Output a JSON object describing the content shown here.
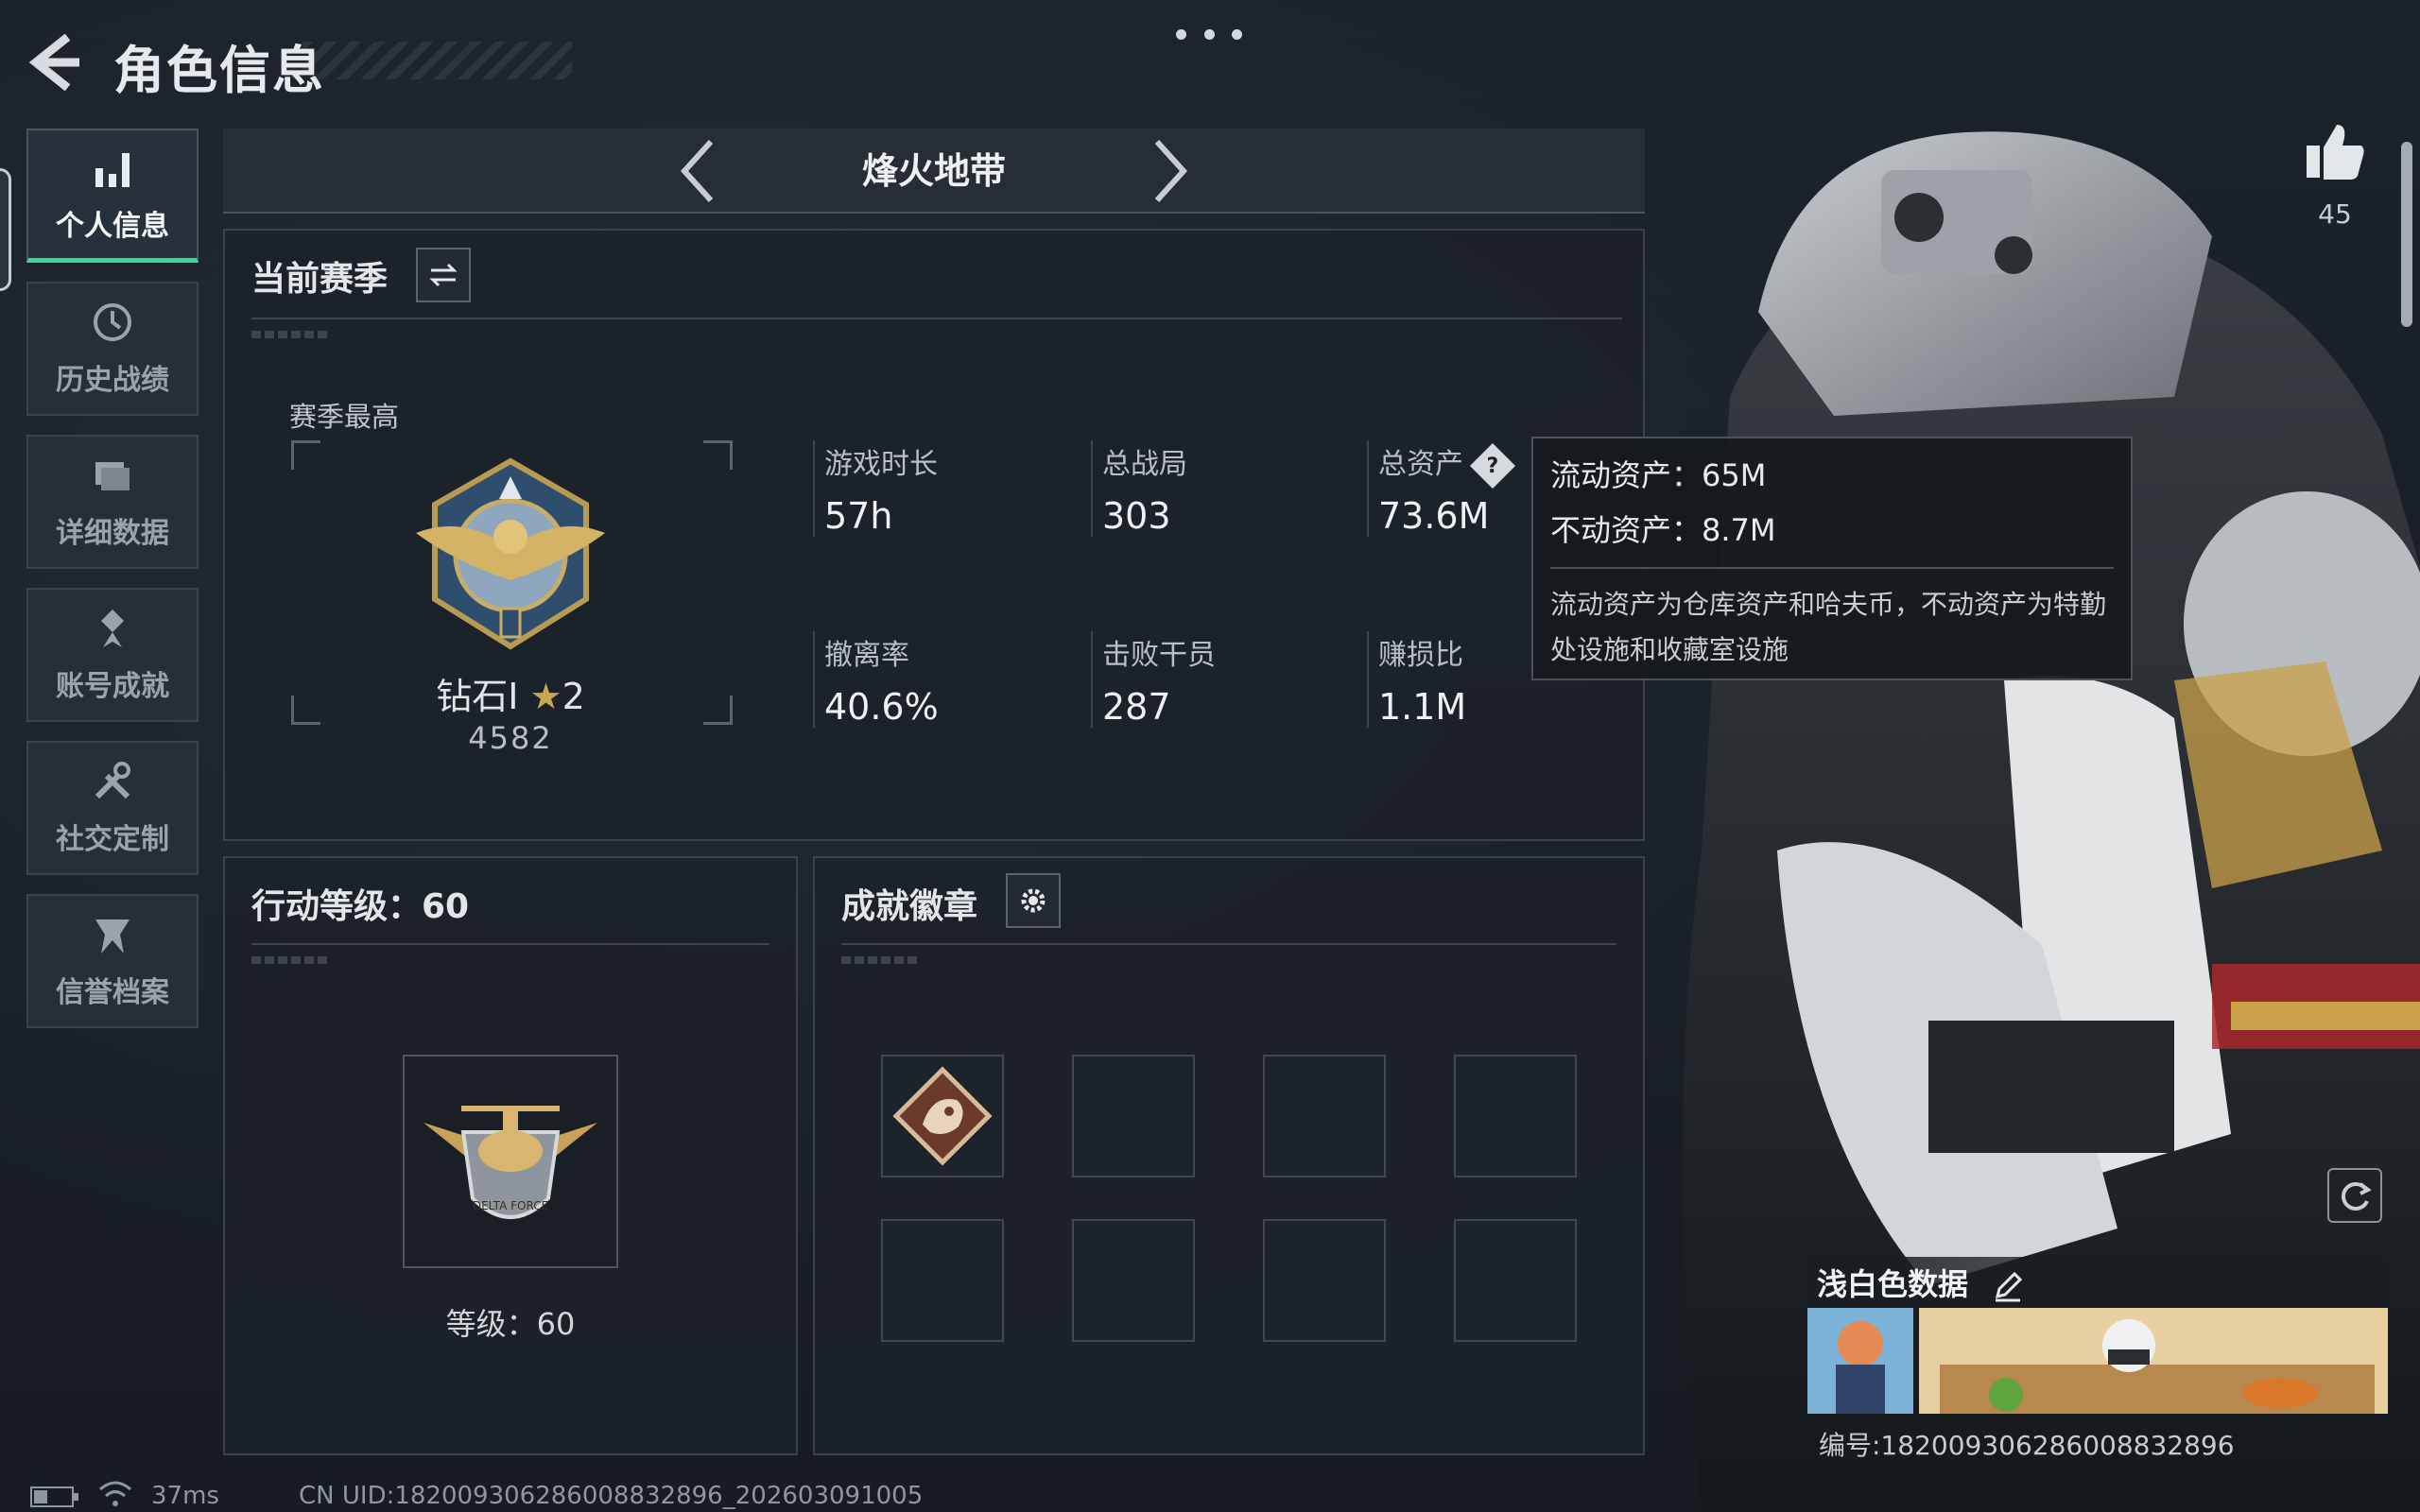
{
  "header": {
    "title": "角色信息"
  },
  "sidebar": {
    "items": [
      {
        "label": "个人信息",
        "icon": "bar-chart-icon",
        "active": true
      },
      {
        "label": "历史战绩",
        "icon": "history-clock-icon"
      },
      {
        "label": "详细数据",
        "icon": "folder-icon"
      },
      {
        "label": "账号成就",
        "icon": "achievement-star-icon"
      },
      {
        "label": "社交定制",
        "icon": "tools-icon"
      },
      {
        "label": "信誉档案",
        "icon": "credit-shield-icon"
      }
    ]
  },
  "mode": {
    "name": "烽火地带"
  },
  "season": {
    "title": "当前赛季",
    "best_label": "赛季最高",
    "rank_name": "钻石I",
    "rank_stars": "2",
    "rank_score": "4582",
    "stats": [
      {
        "key": "游戏时长",
        "value": "57h"
      },
      {
        "key": "总战局",
        "value": "303"
      },
      {
        "key": "总资产",
        "value": "73.6M"
      },
      {
        "key": "撤离率",
        "value": "40.6%"
      },
      {
        "key": "击败干员",
        "value": "287"
      },
      {
        "key": "赚损比",
        "value": "1.1M"
      }
    ]
  },
  "tooltip": {
    "liquid": "流动资产：65M",
    "fixed": "不动资产：8.7M",
    "description": "流动资产为仓库资产和哈夫币，不动资产为特勤处设施和收藏室设施"
  },
  "action_level": {
    "title": "行动等级：60",
    "level_text": "等级：60",
    "emblem_text": "DELTA FORCE"
  },
  "badges": {
    "title": "成就徽章"
  },
  "character": {
    "likes": "45",
    "card_name": "浅白色数据",
    "card_id": "编号:182009306286008832896"
  },
  "footer": {
    "ping": "37ms",
    "uid": "CN UID:182009306286008832896_202603091005"
  },
  "colors": {
    "accent": "#36d89a",
    "background": "#1a2027",
    "panel": "#1c2229"
  }
}
